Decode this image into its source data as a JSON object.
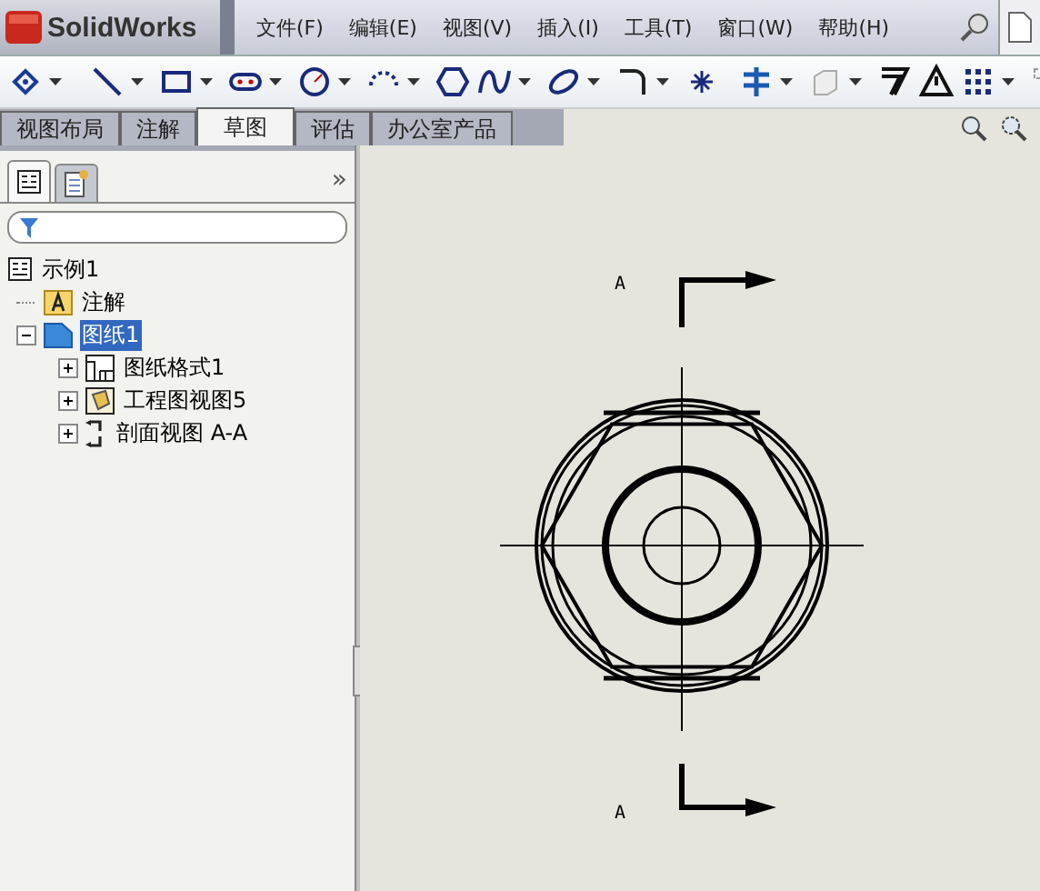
{
  "app": {
    "name": "SolidWorks"
  },
  "menu": [
    "文件(F)",
    "编辑(E)",
    "视图(V)",
    "插入(I)",
    "工具(T)",
    "窗口(W)",
    "帮助(H)"
  ],
  "tabs": [
    {
      "label": "视图布局",
      "selected": false
    },
    {
      "label": "注解",
      "selected": false
    },
    {
      "label": "草图",
      "selected": true
    },
    {
      "label": "评估",
      "selected": false
    },
    {
      "label": "办公室产品",
      "selected": false
    }
  ],
  "panel_tabs": [
    {
      "kind": "tree",
      "selected": true
    },
    {
      "kind": "properties",
      "selected": false
    }
  ],
  "panel_expand": "»",
  "tree": {
    "label": "示例1",
    "kind": "drawing",
    "children": [
      {
        "label": "注解",
        "kind": "annotations"
      },
      {
        "label": "图纸1",
        "kind": "sheet",
        "selected": true,
        "expanded": true,
        "children": [
          {
            "label": "图纸格式1",
            "kind": "format",
            "selected": false,
            "expanded": false
          },
          {
            "label": "工程图视图5",
            "kind": "view",
            "selected": false,
            "expanded": false
          },
          {
            "label": "剖面视图 A-A",
            "kind": "section",
            "selected": false,
            "expanded": false
          }
        ]
      }
    ]
  },
  "drawing": {
    "section_labels": [
      "A",
      "A"
    ]
  }
}
